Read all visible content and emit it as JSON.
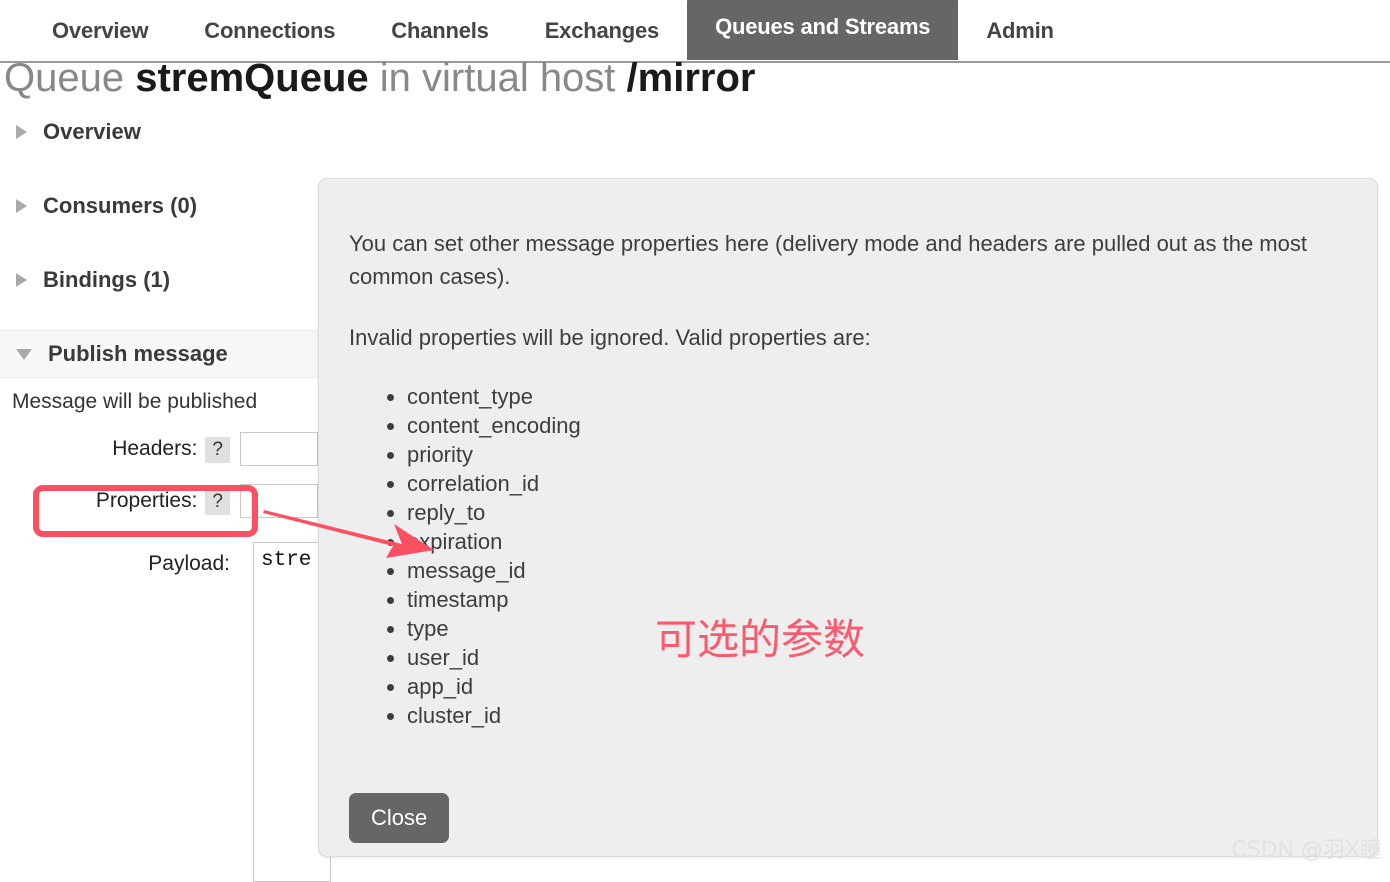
{
  "nav": {
    "tabs": [
      {
        "label": "Overview",
        "active": false
      },
      {
        "label": "Connections",
        "active": false
      },
      {
        "label": "Channels",
        "active": false
      },
      {
        "label": "Exchanges",
        "active": false
      },
      {
        "label": "Queues and Streams",
        "active": true
      },
      {
        "label": "Admin",
        "active": false
      }
    ]
  },
  "page": {
    "title_prefix": "Queue ",
    "title_queue_name": "stremQueue",
    "title_middle": " in virtual host ",
    "title_vhost": "/mirror"
  },
  "sections": [
    {
      "label": "Overview",
      "state": "collapsed"
    },
    {
      "label": "Consumers (0)",
      "state": "collapsed"
    },
    {
      "label": "Bindings (1)",
      "state": "collapsed"
    },
    {
      "label": "Publish message",
      "state": "expanded"
    }
  ],
  "publish": {
    "note": "Message will be published",
    "headers_label": "Headers:",
    "properties_label": "Properties:",
    "payload_label": "Payload:",
    "help_marker": "?",
    "payload_value": "stre"
  },
  "dialog": {
    "paragraph_1": "You can set other message properties here (delivery mode and headers are pulled out as the most common cases).",
    "paragraph_2": "Invalid properties will be ignored. Valid properties are:",
    "properties": [
      "content_type",
      "content_encoding",
      "priority",
      "correlation_id",
      "reply_to",
      "expiration",
      "message_id",
      "timestamp",
      "type",
      "user_id",
      "app_id",
      "cluster_id"
    ],
    "close_label": "Close"
  },
  "annotation": {
    "text": "可选的参数",
    "color": "#fa5a6e",
    "highlight_target": "Properties:"
  },
  "watermark": {
    "text": "CSDN @羽X瞳"
  },
  "colors": {
    "active_tab_bg": "#666666",
    "dialog_bg": "#eeeeee",
    "annotation_red": "#fa5062",
    "text_dark": "#3d3d3d"
  }
}
